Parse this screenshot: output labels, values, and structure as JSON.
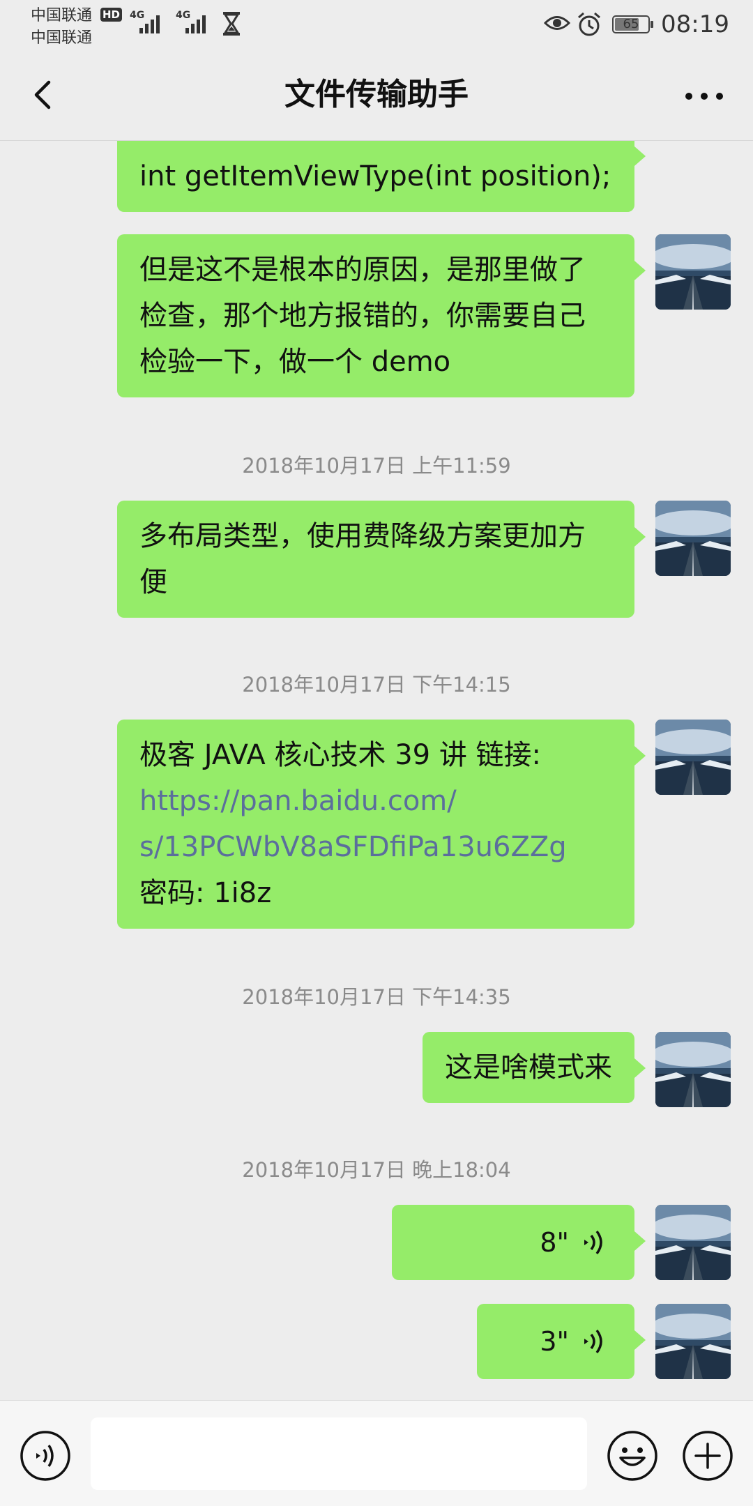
{
  "status": {
    "carrier1": "中国联通",
    "carrier2": "中国联通",
    "hd": "HD",
    "signal_label": "4G",
    "battery": "65",
    "time": "08:19"
  },
  "header": {
    "title": "文件传输助手"
  },
  "messages": [
    {
      "type": "text",
      "text": "int getItemViewType(int position);"
    },
    {
      "type": "text",
      "text": "但是这不是根本的原因，是那里做了检查，那个地方报错的，你需要自己检验一下，做一个 demo"
    },
    {
      "type": "time",
      "text": "2018年10月17日 上午11:59"
    },
    {
      "type": "text",
      "text": "多布局类型，使用费降级方案更加方便"
    },
    {
      "type": "time",
      "text": "2018年10月17日 下午14:15"
    },
    {
      "type": "link",
      "prefix": "极客 JAVA 核心技术 39 讲 链接:",
      "link1": "https://pan.baidu.com/",
      "link2": "s/13PCWbV8aSFDfiPa13u6ZZg",
      "suffix": "密码: 1i8z"
    },
    {
      "type": "time",
      "text": "2018年10月17日 下午14:35"
    },
    {
      "type": "text",
      "text": "这是啥模式来"
    },
    {
      "type": "time",
      "text": "2018年10月17日 晚上18:04"
    },
    {
      "type": "voice",
      "duration": "8\""
    },
    {
      "type": "voice",
      "duration": "3\""
    }
  ],
  "colors": {
    "bubble": "#95ec69",
    "background": "#ededed",
    "link": "#5b6e9c"
  },
  "icons": {
    "back": "back-arrow-icon",
    "more": "more-dots-icon",
    "voice_input": "voice-input-icon",
    "emoji": "emoji-icon",
    "plus": "plus-icon",
    "voice_wave": "voice-wave-icon"
  }
}
